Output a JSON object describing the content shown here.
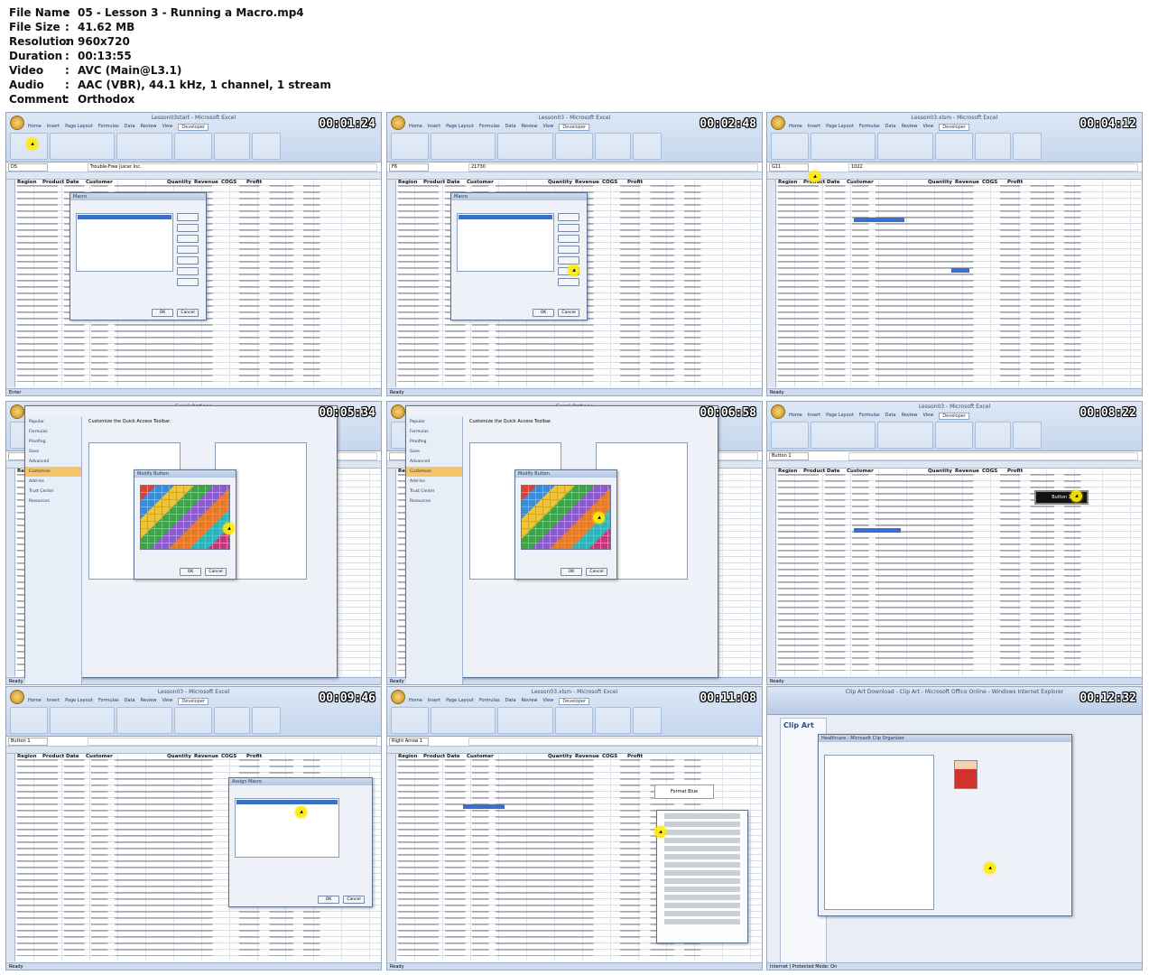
{
  "meta": [
    {
      "key": "File Name",
      "value": "05 - Lesson 3 - Running a Macro.mp4"
    },
    {
      "key": "File Size",
      "value": "41.62 MB"
    },
    {
      "key": "Resolution",
      "value": "960x720"
    },
    {
      "key": "Duration",
      "value": "00:13:55"
    },
    {
      "key": "Video",
      "value": "AVC (Main@L3.1)"
    },
    {
      "key": "Audio",
      "value": "AAC (VBR), 44.1 kHz, 1 channel, 1 stream"
    },
    {
      "key": "Comment",
      "value": "Orthodox"
    }
  ],
  "separator": ":",
  "thumbnails": [
    {
      "timestamp": "00:01:24",
      "kind": "macro-dialog",
      "title": "Lesson03start - Microsoft Excel",
      "namebox": "D5",
      "formula": "Trouble-Free Juicer Inc.",
      "dialog_title": "Macro",
      "status": "Enter"
    },
    {
      "timestamp": "00:02:48",
      "kind": "macro-dialog",
      "title": "Lesson03 - Microsoft Excel",
      "namebox": "F6",
      "formula": "21730",
      "dialog_title": "Macro",
      "status": "Ready"
    },
    {
      "timestamp": "00:04:12",
      "kind": "sheet",
      "title": "Lesson03.xlsm - Microsoft Excel",
      "namebox": "G11",
      "formula": "1022",
      "status": "Ready"
    },
    {
      "timestamp": "00:05:34",
      "kind": "options",
      "title": "Excel Options",
      "dialog_title": "Modify Button",
      "heading": "Customize the Quick Access Toolbar.",
      "status": "Ready"
    },
    {
      "timestamp": "00:06:58",
      "kind": "options",
      "title": "Excel Options",
      "dialog_title": "Modify Button",
      "heading": "Customize the Quick Access Toolbar.",
      "status": "Ready"
    },
    {
      "timestamp": "00:08:22",
      "kind": "sheet-button",
      "title": "Lesson03 - Microsoft Excel",
      "namebox": "Button 1",
      "formula": "",
      "button_label": "Button 1",
      "status": "Ready"
    },
    {
      "timestamp": "00:09:46",
      "kind": "assign-dialog",
      "title": "Lesson03 - Microsoft Excel",
      "namebox": "Button 1",
      "formula": "",
      "dialog_title": "Assign Macro",
      "status": "Ready"
    },
    {
      "timestamp": "00:11:08",
      "kind": "shape-menu",
      "title": "Lesson03.xlsm - Microsoft Excel",
      "namebox": "Right Arrow 1",
      "formula": "",
      "shape_label": "Format Blue",
      "status": "Ready"
    },
    {
      "timestamp": "00:12:32",
      "kind": "clip-art",
      "title": "Clip Art Download - Clip Art - Microsoft Office Online - Windows Internet Explorer",
      "sidebar_title": "Clip Art",
      "dialog_title": "Healthcare - Microsoft Clip Organizer",
      "status": "Internet | Protected Mode: On"
    }
  ],
  "sheet_headers": [
    "Region",
    "Product",
    "Date",
    "Customer",
    "Quantity",
    "Revenue",
    "COGS",
    "Profit"
  ],
  "ribbon_tabs": [
    "Home",
    "Insert",
    "Page Layout",
    "Formulas",
    "Data",
    "Review",
    "View",
    "Developer"
  ],
  "options_nav": [
    "Popular",
    "Formulas",
    "Proofing",
    "Save",
    "Advanced",
    "Customize",
    "Add-Ins",
    "Trust Center",
    "Resources"
  ],
  "options_active": "Customize",
  "dialog_buttons": [
    "OK",
    "Cancel"
  ],
  "colors": {
    "cursor": "#ffeb00",
    "ribbon": "#c5d6ee",
    "selection": "#3b6fc4",
    "timestamp_fill": "#ffffff",
    "timestamp_outline": "#000000"
  }
}
